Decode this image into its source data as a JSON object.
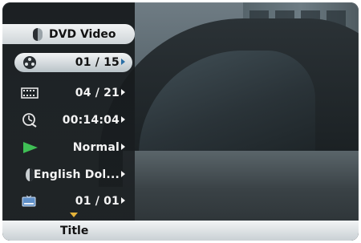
{
  "osd": {
    "header_title": "DVD Video",
    "rows": [
      {
        "name": "chapter-row",
        "icon": "film-reel-icon",
        "value": "01 / 15",
        "selected": true
      },
      {
        "name": "title-row",
        "icon": "film-strip-icon",
        "value": "04 / 21",
        "selected": false
      },
      {
        "name": "time-row",
        "icon": "clock-icon",
        "value": "00:14:04",
        "selected": false
      },
      {
        "name": "playback-mode-row",
        "icon": "play-icon",
        "value": "Normal",
        "selected": false
      },
      {
        "name": "audio-row",
        "icon": "audio-icon",
        "value": "English Dol...",
        "selected": false
      },
      {
        "name": "subtitle-row",
        "icon": "subtitle-icon",
        "value": "01 / 01",
        "selected": false
      }
    ],
    "footer_title": "Title"
  },
  "colors": {
    "panel_bg": "#1b1f22",
    "highlight": "#e9eef0",
    "text_light": "#f4f4f4",
    "scroll_arrow": "#e5b33a"
  }
}
